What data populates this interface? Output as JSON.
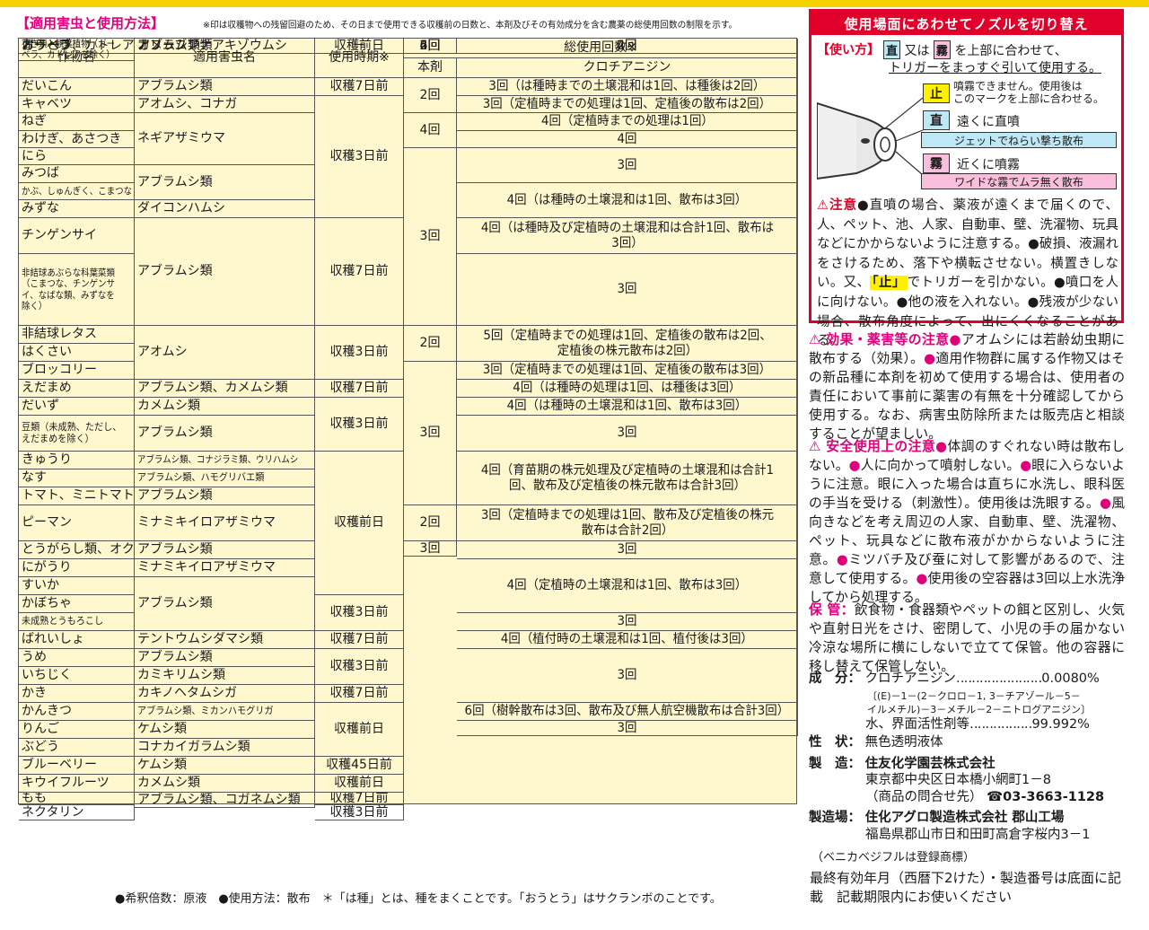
{
  "header": {
    "title": "【適用害虫と使用方法】",
    "note": "※印は収穫物への残留回避のため、その日まで使用できる収穫前の日数と、本剤及びその有効成分を含む農薬の総使用回数の制限を示す。"
  },
  "table": {
    "headers": {
      "crop": "作物名",
      "pest": "適用害虫名",
      "timing": "使用時期※",
      "total": "総使用回数※",
      "this": "本剤",
      "ingredient": "クロチアニジン"
    },
    "cells": [
      {
        "id": "c0",
        "t": "だいこん"
      },
      {
        "id": "c1",
        "t": "キャベツ"
      },
      {
        "id": "c2",
        "t": "ねぎ"
      },
      {
        "id": "c3",
        "t": "わけぎ、あさつき"
      },
      {
        "id": "c4",
        "t": "にら"
      },
      {
        "id": "c5",
        "t": "みつば"
      },
      {
        "id": "c6",
        "t": "かぶ、しゅんぎく、こまつな"
      },
      {
        "id": "c7",
        "t": "みずな"
      },
      {
        "id": "c8",
        "t": "チンゲンサイ"
      },
      {
        "id": "c9",
        "t": "非結球あぶらな科葉菜類（こまつな、チンゲンサイ、なばな類、みずなを除く）"
      },
      {
        "id": "c10",
        "t": "非結球レタス"
      },
      {
        "id": "c11",
        "t": "はくさい"
      },
      {
        "id": "c12",
        "t": "ブロッコリー"
      },
      {
        "id": "c13",
        "t": "えだまめ"
      },
      {
        "id": "c14",
        "t": "だいず"
      },
      {
        "id": "c15",
        "t": "豆類（未成熟、ただし、えだまめを除く）"
      },
      {
        "id": "c16",
        "t": "きゅうり"
      },
      {
        "id": "c17",
        "t": "なす"
      },
      {
        "id": "c18",
        "t": "トマト、ミニトマト"
      },
      {
        "id": "c19",
        "t": "ピーマン"
      },
      {
        "id": "c20",
        "t": "とうがらし類、オクラ"
      },
      {
        "id": "c21",
        "t": "にがうり"
      },
      {
        "id": "c22",
        "t": "すいか"
      },
      {
        "id": "c23",
        "t": "かぼちゃ"
      },
      {
        "id": "c24",
        "t": "未成熟とうもろこし"
      },
      {
        "id": "c25",
        "t": "ばれいしょ"
      },
      {
        "id": "c26",
        "t": "うめ"
      },
      {
        "id": "c27",
        "t": "いちじく"
      },
      {
        "id": "c28",
        "t": "かき"
      },
      {
        "id": "c29",
        "t": "かんきつ"
      },
      {
        "id": "c30",
        "t": "りんご"
      },
      {
        "id": "c31",
        "t": "ぶどう"
      },
      {
        "id": "c32",
        "t": "ブルーベリー"
      },
      {
        "id": "c33",
        "t": "キウイフルーツ"
      },
      {
        "id": "c34",
        "t": "もも"
      },
      {
        "id": "c35",
        "t": "ネクタリン"
      },
      {
        "id": "c36",
        "t": "おうとう"
      },
      {
        "id": "c37",
        "t": "オリーブ"
      },
      {
        "id": "c38",
        "t": "ガーベラ、カトレア"
      },
      {
        "id": "c39",
        "t": "花き類・観葉植物（ガーベラ、カトレアを除く）"
      },
      {
        "id": "p0",
        "t": "アブラムシ類"
      },
      {
        "id": "p1",
        "t": "アオムシ、コナガ"
      },
      {
        "id": "p2",
        "t": "ネギアザミウマ"
      },
      {
        "id": "p3",
        "t": "アブラムシ類"
      },
      {
        "id": "p4",
        "t": "ダイコンハムシ"
      },
      {
        "id": "p5",
        "t": "アブラムシ類"
      },
      {
        "id": "p6",
        "t": "アオムシ"
      },
      {
        "id": "p7",
        "t": "アブラムシ類、カメムシ類"
      },
      {
        "id": "p8",
        "t": "カメムシ類"
      },
      {
        "id": "p9",
        "t": "アブラムシ類"
      },
      {
        "id": "p10",
        "t": "アブラムシ類、コナジラミ類、ウリハムシ"
      },
      {
        "id": "p11",
        "t": "アブラムシ類、ハモグリバエ類"
      },
      {
        "id": "p12",
        "t": "アブラムシ類"
      },
      {
        "id": "p13",
        "t": "ミナミキイロアザミウマ"
      },
      {
        "id": "p14",
        "t": "アブラムシ類"
      },
      {
        "id": "p15",
        "t": "ミナミキイロアザミウマ"
      },
      {
        "id": "p16",
        "t": "アブラムシ類"
      },
      {
        "id": "p17",
        "t": "テントウムシダマシ類"
      },
      {
        "id": "p18",
        "t": "アブラムシ類"
      },
      {
        "id": "p19",
        "t": "カミキリムシ類"
      },
      {
        "id": "p20",
        "t": "カキノヘタムシガ"
      },
      {
        "id": "p21",
        "t": "アブラムシ類、ミカンハモグリガ"
      },
      {
        "id": "p22",
        "t": "ケムシ類"
      },
      {
        "id": "p23",
        "t": "コナカイガラムシ類"
      },
      {
        "id": "p24",
        "t": "ケムシ類"
      },
      {
        "id": "p25",
        "t": "カメムシ類"
      },
      {
        "id": "p26",
        "t": "アブラムシ類、コガネムシ類"
      },
      {
        "id": "p27",
        "t": "カメムシ類"
      },
      {
        "id": "p28",
        "t": "オリーブアナアキゾウムシ"
      },
      {
        "id": "p29",
        "t": "アブラムシ類"
      },
      {
        "id": "t0",
        "t": "収穫7日前"
      },
      {
        "id": "t1",
        "t": "収穫3日前"
      },
      {
        "id": "t2",
        "t": "収穫7日前"
      },
      {
        "id": "t3",
        "t": "収穫3日前"
      },
      {
        "id": "t4",
        "t": "収穫7日前"
      },
      {
        "id": "t5",
        "t": "収穫3日前"
      },
      {
        "id": "t6",
        "t": "収穫前日"
      },
      {
        "id": "t7",
        "t": "収穫3日前"
      },
      {
        "id": "t8",
        "t": "収穫7日前"
      },
      {
        "id": "t9",
        "t": "収穫3日前"
      },
      {
        "id": "t10",
        "t": "収穫7日前"
      },
      {
        "id": "t11",
        "t": "収穫前日"
      },
      {
        "id": "t12",
        "t": "収穫45日前"
      },
      {
        "id": "t13",
        "t": "収穫前日"
      },
      {
        "id": "t14",
        "t": "収穫7日前"
      },
      {
        "id": "t15",
        "t": "収穫3日前"
      },
      {
        "id": "t16",
        "t": "収穫前日"
      },
      {
        "id": "t17",
        "t": "－"
      },
      {
        "id": "h0",
        "t": "2回"
      },
      {
        "id": "h1",
        "t": "4回"
      },
      {
        "id": "h2",
        "t": "3回"
      },
      {
        "id": "h3",
        "t": "2回"
      },
      {
        "id": "h4",
        "t": "3回"
      },
      {
        "id": "h5",
        "t": "2回"
      },
      {
        "id": "h6",
        "t": "3回"
      },
      {
        "id": "h7",
        "t": "2回"
      },
      {
        "id": "h8",
        "t": "6回"
      },
      {
        "id": "h9",
        "t": "4回"
      },
      {
        "id": "k0",
        "t": "3回（は種時までの土壌混和は1回、は種後は2回）"
      },
      {
        "id": "k1",
        "t": "3回（定植時までの処理は1回、定植後の散布は2回）"
      },
      {
        "id": "k2",
        "t": "4回（定植時までの処理は1回）"
      },
      {
        "id": "k3",
        "t": "4回"
      },
      {
        "id": "k4",
        "t": "3回"
      },
      {
        "id": "k5",
        "t": "4回（は種時の土壌混和は1回、散布は3回）"
      },
      {
        "id": "k6",
        "t": "4回（は種時及び定植時の土壌混和は合計1回、散布は3回）"
      },
      {
        "id": "k7",
        "t": "3回"
      },
      {
        "id": "k8",
        "t": "5回（定植時までの処理は1回、定植後の散布は2回、定植後の株元散布は2回）"
      },
      {
        "id": "k9",
        "t": "3回（定植時までの処理は1回、定植後の散布は3回）"
      },
      {
        "id": "k10",
        "t": "4回（は種時の処理は1回、は種後は3回）"
      },
      {
        "id": "k11",
        "t": "4回（は種時の土壌混和は1回、散布は3回）"
      },
      {
        "id": "k12",
        "t": "3回"
      },
      {
        "id": "k13",
        "t": "4回（育苗期の株元処理及び定植時の土壌混和は合計1回、散布及び定植後の株元散布は合計3回）"
      },
      {
        "id": "k14",
        "t": "3回（定植時までの処理は1回、散布及び定植後の株元散布は合計2回）"
      },
      {
        "id": "k15",
        "t": "3回"
      },
      {
        "id": "k16",
        "t": "4回（定植時の土壌混和は1回、散布は3回）"
      },
      {
        "id": "k17",
        "t": "3回"
      },
      {
        "id": "k18",
        "t": "4回（植付時の土壌混和は1回、植付後は3回）"
      },
      {
        "id": "k19",
        "t": "3回"
      },
      {
        "id": "k20",
        "t": "6回（樹幹散布は3回、散布及び無人航空機散布は合計3回）"
      },
      {
        "id": "k21",
        "t": "3回"
      },
      {
        "id": "k22",
        "t": "2回"
      },
      {
        "id": "k23",
        "t": "4回"
      }
    ]
  },
  "footnote": "●希釈倍数：原液　●使用方法：散布　＊「は種」とは、種をまくことです。「おうとう」はサクランボのことです。",
  "nozzle": {
    "title": "使用場面にあわせてノズルを切り替え",
    "usage_label": "【使い方】",
    "usage_chip_straight": "直",
    "usage_mid": "又は",
    "usage_chip_mist": "霧",
    "usage_tail": "を上部に合わせて、",
    "usage_line2": "トリガーをまっすぐ引いて使用する。",
    "stop_chip": "止",
    "stop_text_1": "噴霧できません。使用後は",
    "stop_text_2": "このマークを上部に合わせる。",
    "straight_chip": "直",
    "straight_text": "遠くに直噴",
    "straight_bar": "ジェットでねらい撃ち散布",
    "mist_chip": "霧",
    "mist_text": "近くに噴霧",
    "mist_bar": "ワイドな霧でムラ無く散布",
    "caution_head": "⚠注意",
    "caution_1": "●直噴の場合、薬液が遠くまで届くので、人、ペット、池、人家、自動車、壁、洗濯物、玩具などにかからないように注意する。●破損、液漏れをさけるため、落下や横転させない。横置きしない。又、",
    "caution_stop": "「止」",
    "caution_2": "でトリガーを引かない。●噴口を人に向けない。●他の液を入れない。●残液が少ない場合、散布角度によって、出にくくなることがある。"
  },
  "effect": {
    "head": "⚠ 効果・薬害等の注意",
    "b1": "●",
    "t1": "アオムシには若齢幼虫期に散布する（効果）。",
    "b2": "●",
    "t2": "適用作物群に属する作物又はその新品種に本剤を初めて使用する場合は、使用者の責任において事前に薬害の有無を十分確認してから使用する。なお、病害虫防除所または販売店と相談することが望ましい。"
  },
  "safety": {
    "head": "⚠ 安全使用上の注意",
    "items": [
      "●",
      "体調のすぐれない時は散布しない。",
      "●",
      "人に向かって噴射しない。",
      "●",
      "眼に入らないように注意。眼に入った場合は直ちに水洗し、眼科医の手当を受ける（刺激性）。使用後は洗眼する。",
      "●",
      "風向きなどを考え周辺の人家、自動車、壁、洗濯物、ペット、玩具などに散布液がかからないように注意。",
      "●",
      "ミツバチ及び蚕に対して影響があるので、注意して使用する。",
      "●",
      "使用後の空容器は3回以上水洗浄してから処理する。"
    ]
  },
  "storage": {
    "head": "保 管：",
    "text": "飲食物・食器類やペットの餌と区別し、火気や直射日光をさけ、密閉して、小児の手の届かない冷涼な場所に横にしないで立てて保管。他の容器に移し替えて保管しない。"
  },
  "specs": {
    "comp_label": "成　分：",
    "comp_name": "クロチアニジン",
    "comp_value": "0.0080%",
    "comp_chem_1": "〔(E)－1－(2－クロロ－1, 3－チアゾール－5－",
    "comp_chem_2": "イルメチル)－3－メチル－2－ニトログアニジン〕",
    "comp_other": "水、界面活性剤等",
    "comp_other_value": "99.992%",
    "state_label": "性　状：",
    "state_value": "無色透明液体",
    "maker_label": "製　造：",
    "maker_name": "住友化学園芸株式会社",
    "maker_addr": "東京都中央区日本橋小網町1－8",
    "maker_contact": "（商品の問合せ先）",
    "maker_tel": "☎03-3663-1128",
    "plant_label": "製造場：",
    "plant_name": "住化アグロ製造株式会社 郡山工場",
    "plant_addr": "福島県郡山市日和田町高倉字桜内3－1",
    "trademark": "（ベニカベジフルは登録商標）",
    "expiry": "最終有効年月（西暦下2けた）・製造番号は底面に記載　記載期限内にお使いください"
  }
}
